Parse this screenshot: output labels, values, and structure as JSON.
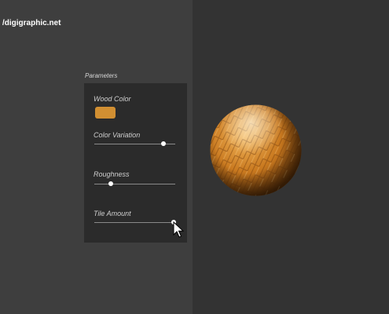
{
  "watermark": "/digigraphic.net",
  "panel": {
    "title": "Parameters",
    "wood_color": {
      "label": "Wood Color",
      "color": "#d18f32"
    },
    "color_variation": {
      "label": "Color Variation",
      "value": 0.85
    },
    "roughness": {
      "label": "Roughness",
      "value": 0.2
    },
    "tile_amount": {
      "label": "Tile Amount",
      "value": 0.98
    }
  },
  "preview": {
    "material": "wood-parquet-sphere",
    "base_color": "#c87a22"
  }
}
